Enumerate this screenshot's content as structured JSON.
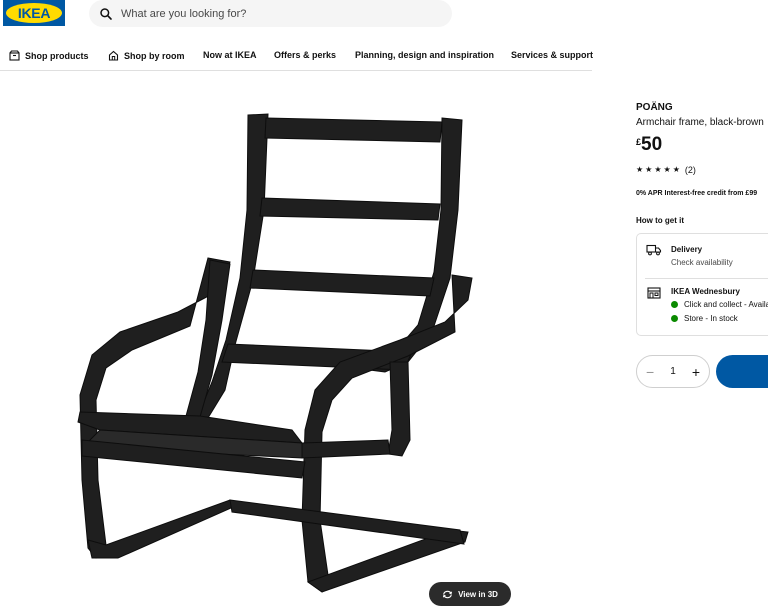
{
  "header": {
    "logo_text": "IKEA",
    "search_placeholder": "What are you looking for?"
  },
  "nav": {
    "items": [
      {
        "label": "Shop products",
        "icon": "box-icon"
      },
      {
        "label": "Shop by room",
        "icon": "house-icon"
      },
      {
        "label": "Now at IKEA"
      },
      {
        "label": "Offers & perks"
      },
      {
        "label": "Planning, design and inspiration"
      },
      {
        "label": "Services & support"
      }
    ]
  },
  "gallery": {
    "view3d_label": "View in 3D"
  },
  "product": {
    "name": "POÄNG",
    "description": "Armchair frame, black-brown",
    "currency": "£",
    "price": "50",
    "rating": 5,
    "rating_count": "(2)",
    "apr_text": "0% APR Interest-free credit from £99",
    "how_to_get": "How to get it",
    "delivery_title": "Delivery",
    "delivery_sub": "Check availability",
    "store_title": "IKEA Wednesbury",
    "click_collect": "Click and collect - Available",
    "store_stock": "Store - In stock",
    "quantity": "1"
  },
  "colors": {
    "brand_blue": "#0058a3",
    "brand_yellow": "#ffdb00",
    "in_stock_green": "#0a8a00"
  }
}
